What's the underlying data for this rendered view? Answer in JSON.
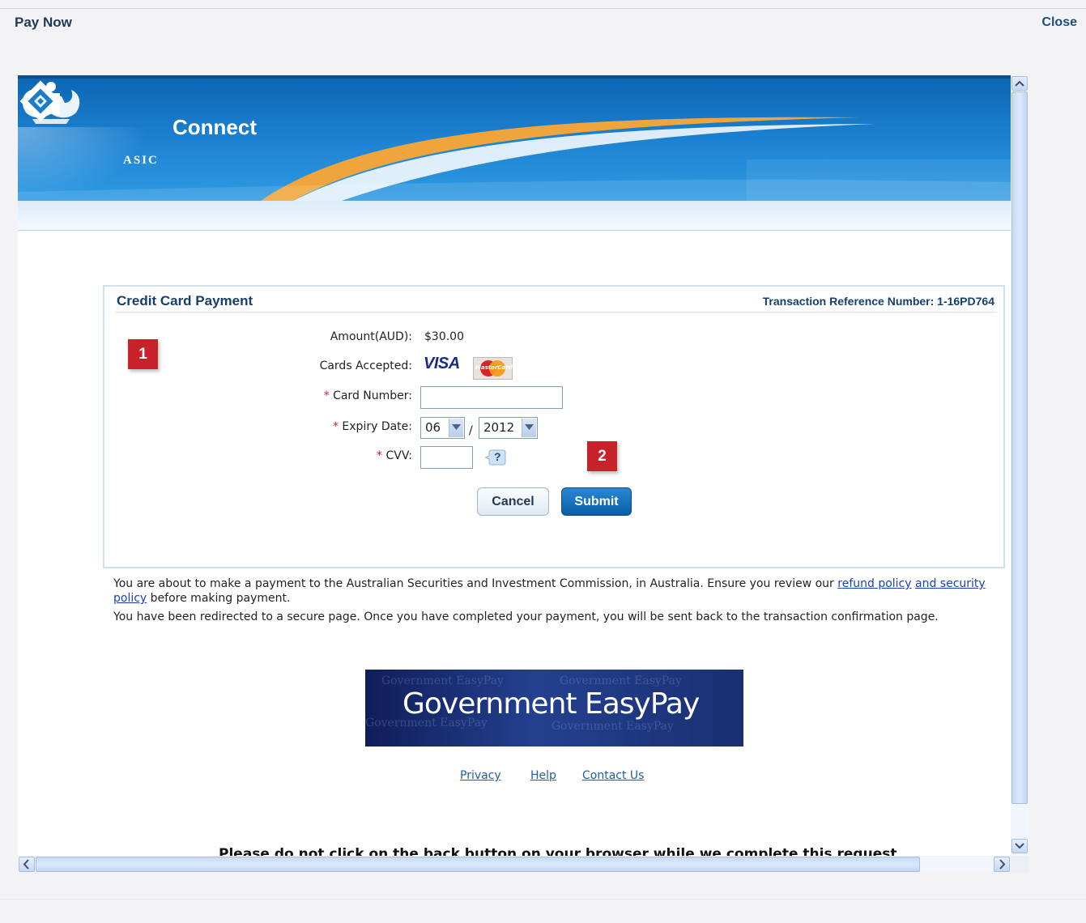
{
  "dialog": {
    "title": "Pay Now",
    "close_label": "Close"
  },
  "banner": {
    "brand": "Connect",
    "org": "ASIC"
  },
  "payment": {
    "heading": "Credit Card Payment",
    "reference": "Transaction Reference Number: 1-16PD764",
    "amount_label": "Amount(AUD):",
    "amount_value": "$30.00",
    "cards_label": "Cards Accepted:",
    "cards": [
      "VISA",
      "MasterCard"
    ],
    "card_number_label": "Card Number:",
    "card_number_value": "",
    "expiry_label": "Expiry Date:",
    "expiry_month": "06",
    "expiry_year": "2012",
    "expiry_separator": "/",
    "cvv_label": "CVV:",
    "cvv_value": "",
    "cvv_help": "?",
    "cancel_label": "Cancel",
    "submit_label": "Submit"
  },
  "callouts": [
    "1",
    "2"
  ],
  "notice": {
    "p1_text": "You are about to make a payment to the Australian Securities and Investment Commission, in Australia. Ensure you review our",
    "p1_link_a": "refund policy",
    "p1_link_b": "and security policy",
    "p1_after": "before making payment.",
    "p2_text": "You have been redirected to a secure page. Once you have completed your payment, you will be sent back to the transaction confirmation page."
  },
  "easypay": {
    "title": "Government EasyPay"
  },
  "footer_links": [
    "Privacy",
    "Help",
    "Contact Us"
  ],
  "warning": "Please do not click on the back button on your browser while we complete this request",
  "colors": {
    "accent": "#0b5ea8",
    "badge": "#c7222a",
    "heading": "#173f6e"
  }
}
